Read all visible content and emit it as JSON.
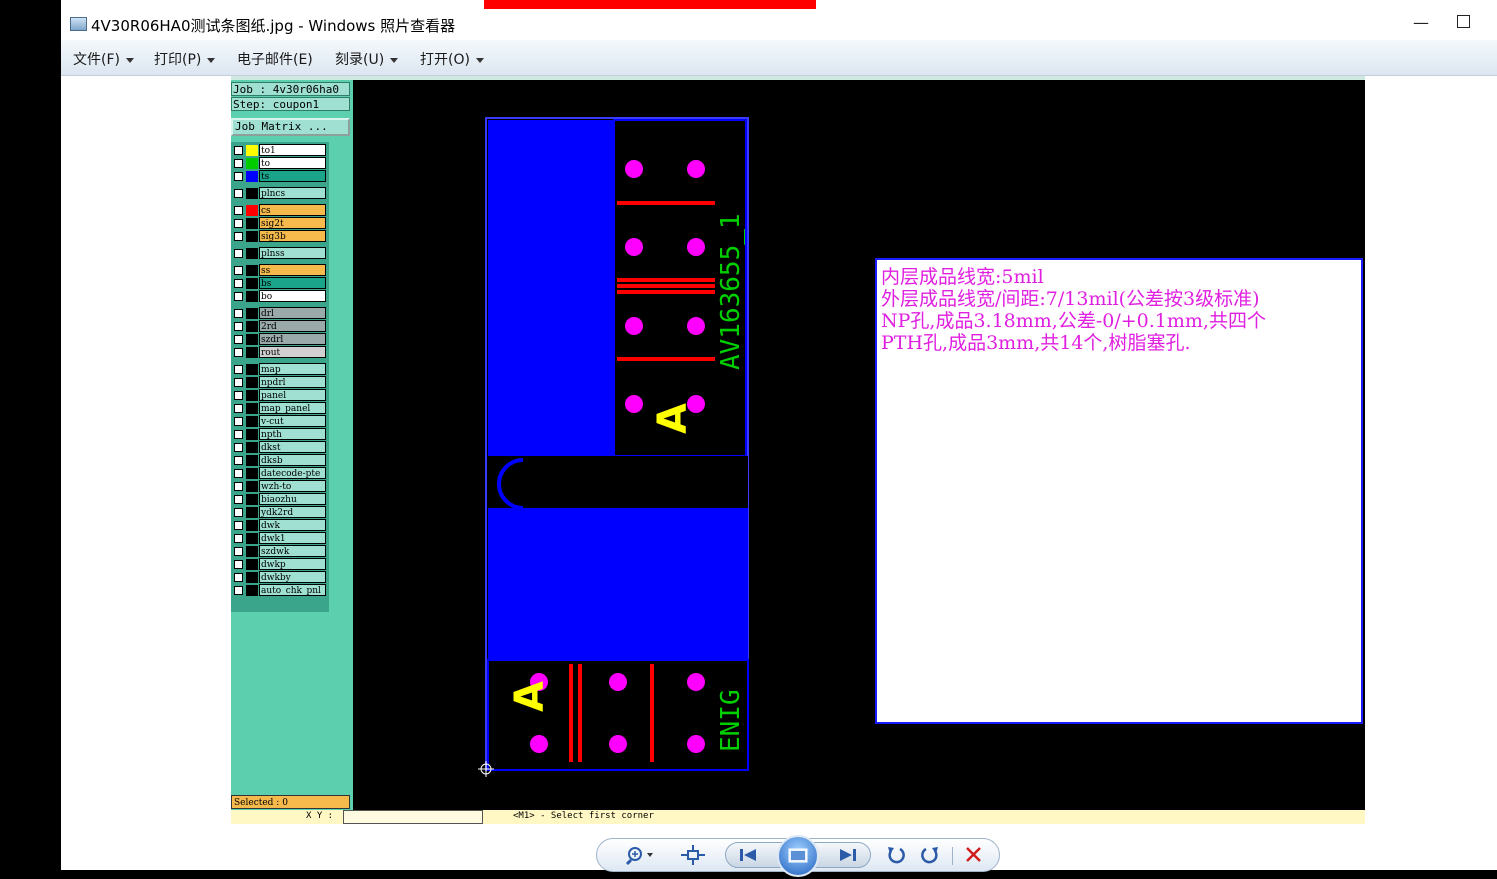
{
  "window": {
    "title": "4V30R06HA0测试条图纸.jpg - Windows 照片查看器",
    "min_glyph": "—"
  },
  "menu": [
    {
      "label": "文件(F)"
    },
    {
      "label": "打印(P)"
    },
    {
      "label": "电子邮件(E)"
    },
    {
      "label": "刻录(U)"
    },
    {
      "label": "打开(O)"
    }
  ],
  "cam": {
    "job": "Job : 4v30r06ha0",
    "step": "Step: coupon1",
    "job_matrix": "Job Matrix ...",
    "selected": "Selected : 0",
    "command": "<M1> - Select first corner",
    "coord": "X Y :",
    "layers": [
      {
        "name": "to1",
        "color": "#ffff00",
        "bg": "#ffffff"
      },
      {
        "name": "to",
        "color": "#00cc00",
        "bg": "#ffffff"
      },
      {
        "name": "ts",
        "color": "#0000ff",
        "bg": "#1aa58b"
      },
      {
        "name": "plncs",
        "color": "#000000",
        "bg": "#9fe0d2"
      },
      {
        "name": "cs",
        "color": "#ff0000",
        "bg": "#f6b94c"
      },
      {
        "name": "sig2t",
        "color": "#000000",
        "bg": "#f6b94c"
      },
      {
        "name": "sig3b",
        "color": "#000000",
        "bg": "#f6b94c"
      },
      {
        "name": "plnss",
        "color": "#000000",
        "bg": "#9fe0d2"
      },
      {
        "name": "ss",
        "color": "#000000",
        "bg": "#f6b94c"
      },
      {
        "name": "bs",
        "color": "#000000",
        "bg": "#1aa58b"
      },
      {
        "name": "bo",
        "color": "#000000",
        "bg": "#ffffff"
      },
      {
        "name": "drl",
        "color": "#000000",
        "bg": "#9aa9a9"
      },
      {
        "name": "2rd",
        "color": "#000000",
        "bg": "#9aa9a9"
      },
      {
        "name": "szdrl",
        "color": "#000000",
        "bg": "#9aa9a9"
      },
      {
        "name": "rout",
        "color": "#000000",
        "bg": "#d0d0d0"
      },
      {
        "name": "map",
        "color": "#000000",
        "bg": "#9fe0d2"
      },
      {
        "name": "npdrl",
        "color": "#000000",
        "bg": "#9fe0d2"
      },
      {
        "name": "panel",
        "color": "#000000",
        "bg": "#9fe0d2"
      },
      {
        "name": "map_panel",
        "color": "#000000",
        "bg": "#9fe0d2"
      },
      {
        "name": "v-cut",
        "color": "#000000",
        "bg": "#9fe0d2"
      },
      {
        "name": "npth",
        "color": "#000000",
        "bg": "#9fe0d2"
      },
      {
        "name": "dkst",
        "color": "#000000",
        "bg": "#9fe0d2"
      },
      {
        "name": "dksb",
        "color": "#000000",
        "bg": "#9fe0d2"
      },
      {
        "name": "datecode-pte",
        "color": "#000000",
        "bg": "#9fe0d2"
      },
      {
        "name": "wzh-to",
        "color": "#000000",
        "bg": "#9fe0d2"
      },
      {
        "name": "biaozhu",
        "color": "#000000",
        "bg": "#9fe0d2"
      },
      {
        "name": "ydk2rd",
        "color": "#000000",
        "bg": "#9fe0d2"
      },
      {
        "name": "dwk",
        "color": "#000000",
        "bg": "#9fe0d2"
      },
      {
        "name": "dwk1",
        "color": "#000000",
        "bg": "#9fe0d2"
      },
      {
        "name": "szdwk",
        "color": "#000000",
        "bg": "#9fe0d2"
      },
      {
        "name": "dwkp",
        "color": "#000000",
        "bg": "#9fe0d2"
      },
      {
        "name": "dwkby",
        "color": "#000000",
        "bg": "#9fe0d2"
      },
      {
        "name": "auto_chk_pnl",
        "color": "#000000",
        "bg": "#9fe0d2"
      }
    ]
  },
  "board": {
    "label_top": "AV163655_1",
    "label_bottom": "ENIG",
    "glyph": "A"
  },
  "notes": [
    "内层成品线宽:5mil",
    "外层成品线宽/间距:7/13mil(公差按3级标准)",
    "NP孔,成品3.18mm,公差-0/+0.1mm,共四个",
    "PTH孔,成品3mm,共14个,树脂塞孔."
  ],
  "colors": {
    "board_blue": "#0000ff",
    "pad_magenta": "#ff00ff",
    "trace_red": "#ff0000",
    "silk_green": "#00d000",
    "silk_yellow": "#ffff00",
    "note_magenta": "#e020e0",
    "arrow_red": "#ff0000"
  }
}
